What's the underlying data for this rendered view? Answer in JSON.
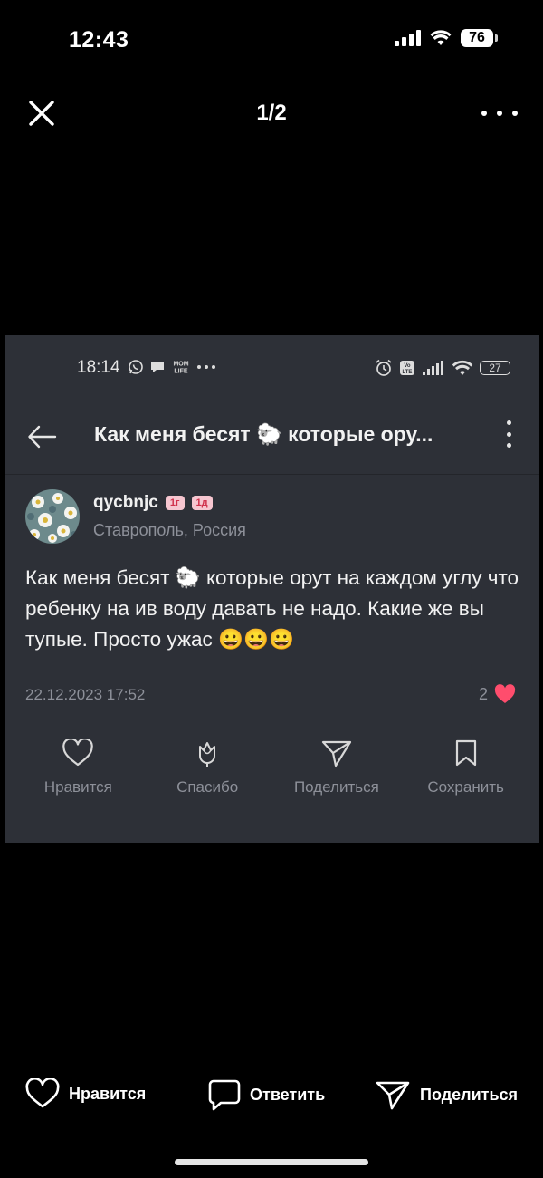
{
  "ios_status": {
    "time": "12:43",
    "battery": "76"
  },
  "viewer": {
    "counter": "1/2"
  },
  "screenshot": {
    "android_status": {
      "time": "18:14",
      "battery": "27",
      "mom_life_icon_text": "MOM LIFE"
    },
    "header": {
      "title": "Как меня бесят 🐑 которые ору..."
    },
    "post": {
      "author": "qycbnjc",
      "badges": [
        "1г",
        "1д"
      ],
      "location": "Ставрополь, Россия",
      "text": "Как меня бесят 🐑 которые орут на каждом углу что ребенку на ив воду давать не надо. Какие же вы тупые. Просто ужас 😀😀😀",
      "date": "22.12.2023 17:52",
      "like_count": "2"
    },
    "actions": [
      {
        "label": "Нравится",
        "icon": "heart-outline-icon"
      },
      {
        "label": "Спасибо",
        "icon": "tulip-icon"
      },
      {
        "label": "Поделиться",
        "icon": "send-icon"
      },
      {
        "label": "Сохранить",
        "icon": "bookmark-icon"
      }
    ],
    "colors": {
      "background": "#2d3037",
      "accent_heart": "#ff4d6d",
      "muted_text": "#8d9099"
    }
  },
  "bottom_bar": {
    "like_label": "Нравится",
    "reply_label": "Ответить",
    "share_label": "Поделиться"
  }
}
